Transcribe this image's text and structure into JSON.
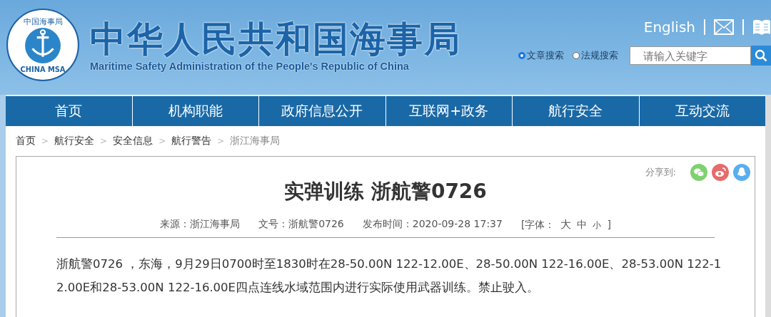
{
  "header": {
    "logo": {
      "top_text": "中国海事局",
      "bottom_text": "CHINA MSA"
    },
    "title": "中华人民共和国海事局",
    "subtitle": "Maritime Safety Administration of the People's Republic of China",
    "language_link": "English",
    "search_scopes": [
      {
        "label": "文章搜索",
        "selected": true
      },
      {
        "label": "法规搜索",
        "selected": false
      }
    ],
    "search": {
      "placeholder": "请输入关键字"
    }
  },
  "nav": [
    {
      "label": "首页"
    },
    {
      "label": "机构职能"
    },
    {
      "label": "政府信息公开"
    },
    {
      "label": "互联网+政务"
    },
    {
      "label": "航行安全"
    },
    {
      "label": "互动交流"
    }
  ],
  "breadcrumb": {
    "separator": ">",
    "items": [
      "首页",
      "航行安全",
      "安全信息",
      "航行警告",
      "浙江海事局"
    ]
  },
  "article": {
    "share_label": "分享到:",
    "title": "实弹训练 浙航警0726",
    "meta": [
      "来源：浙江海事局",
      "文号：浙航警0726",
      "发布时间：2020-09-28 17:37"
    ],
    "font_label": "[字体：",
    "font_sizes": [
      "大",
      "中",
      "小"
    ],
    "font_close": "]",
    "body": "浙航警0726 ，东海，9月29日0700时至1830时在28-50.00N 122-12.00E、28-50.00N 122-16.00E、28-53.00N 122-12.00E和28-53.00N 122-16.00E四点连线水域范围内进行实际使用武器训练。禁止驶入。"
  }
}
